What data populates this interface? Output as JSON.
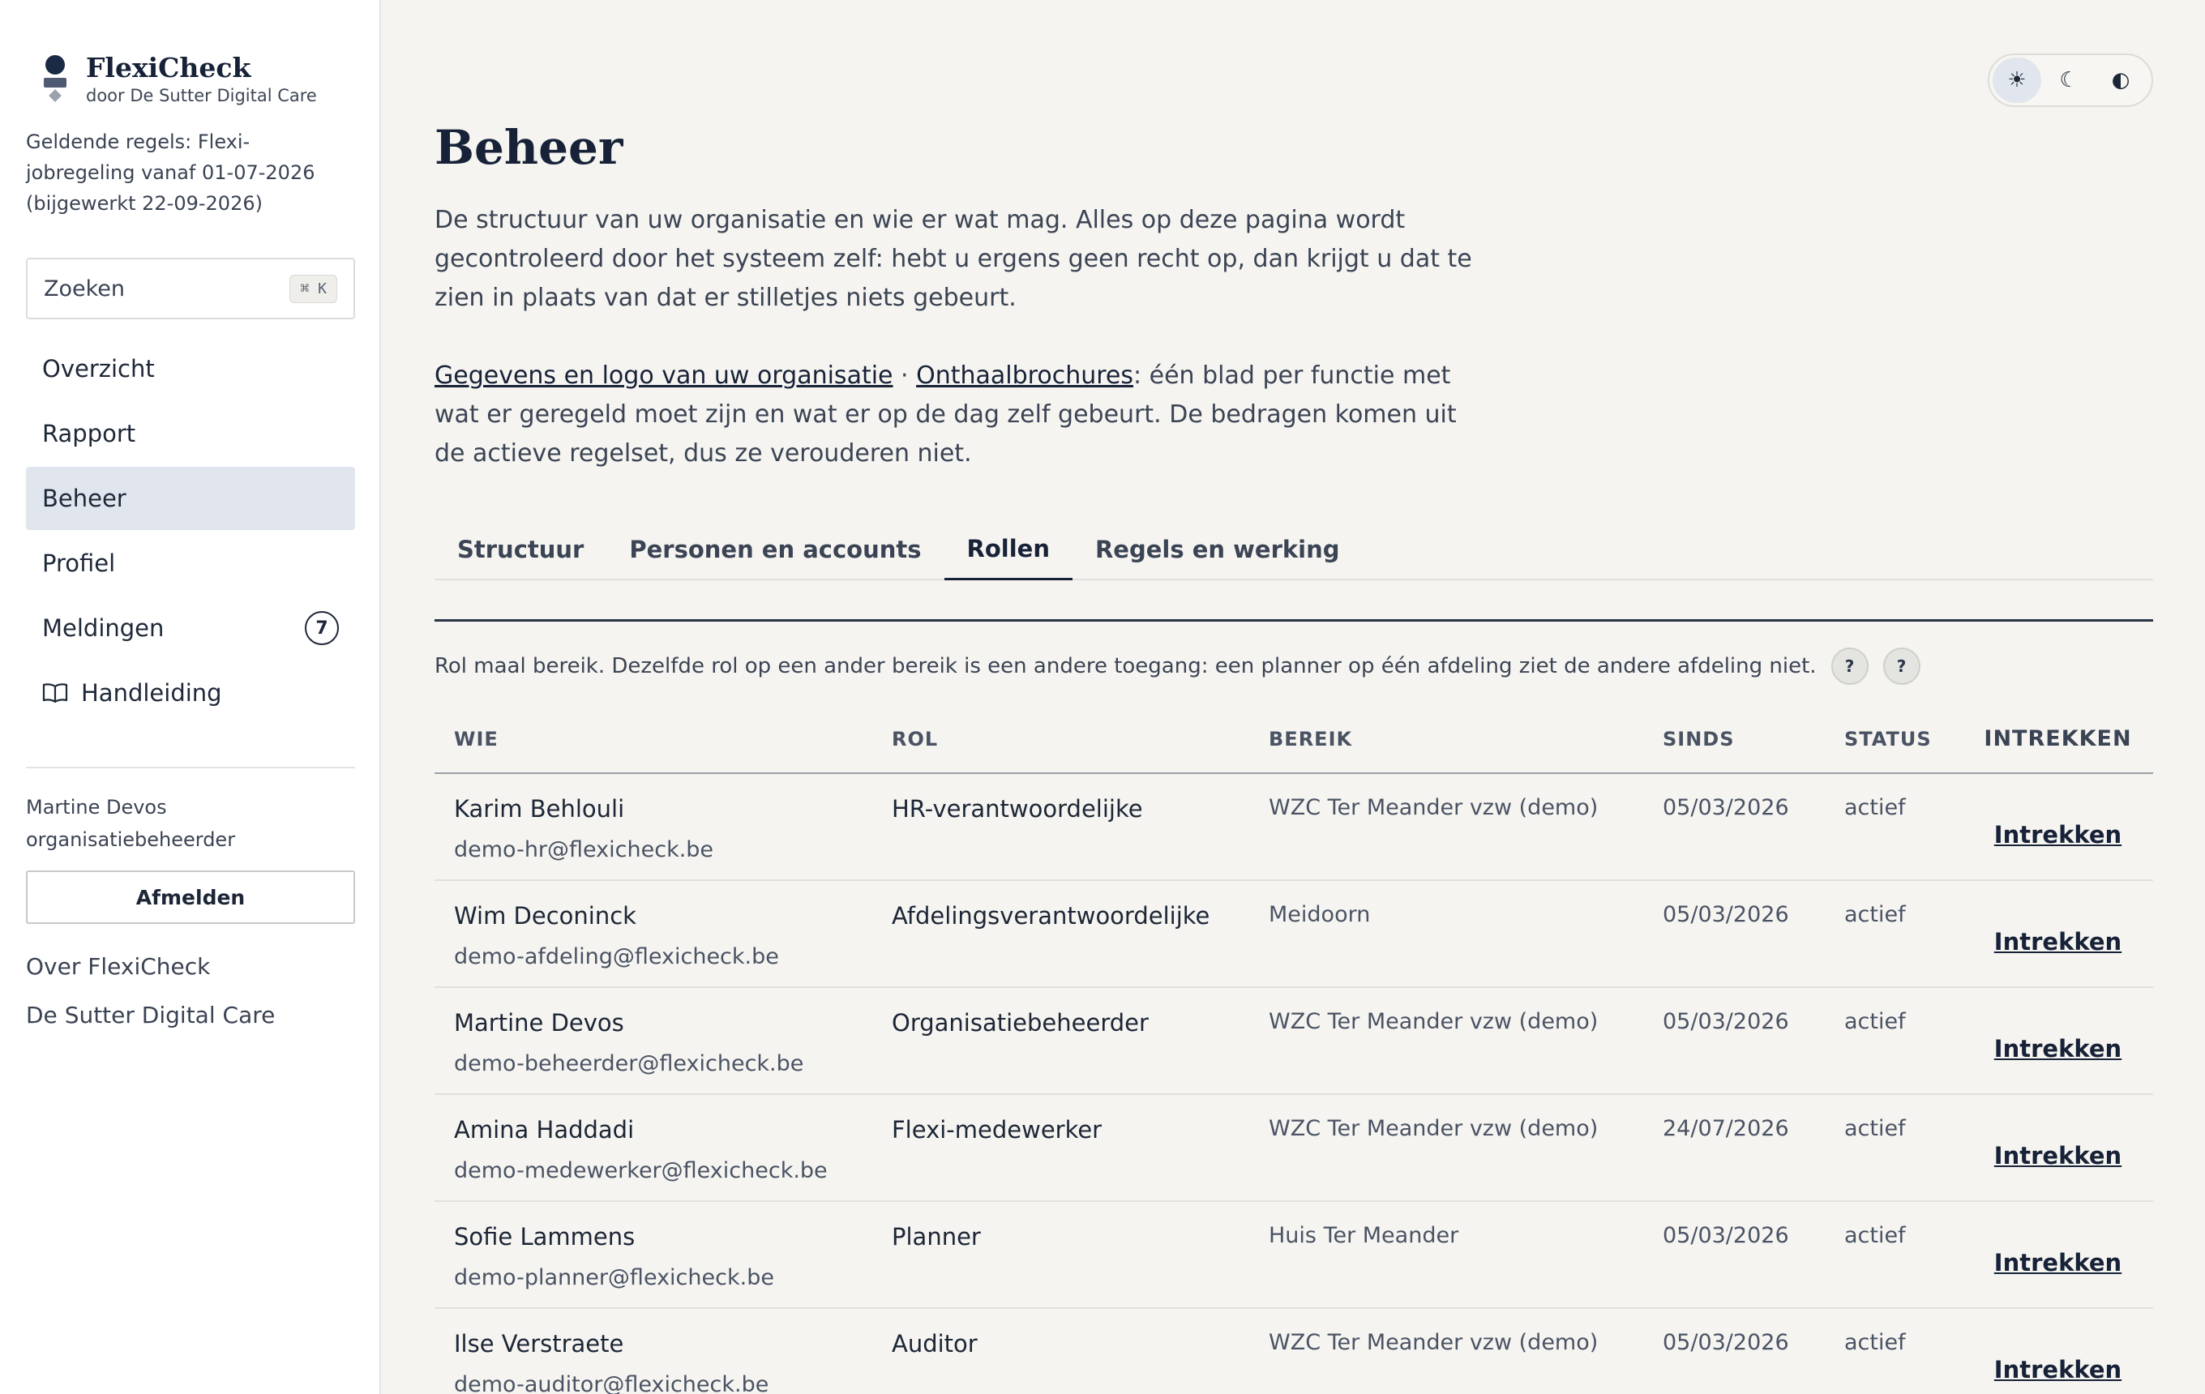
{
  "brand": {
    "title": "FlexiCheck",
    "subtitle": "door De Sutter Digital Care"
  },
  "rules_note": "Geldende regels: Flexi-jobregeling vanaf 01-07-2026 (bijgewerkt 22-09-2026)",
  "search": {
    "label": "Zoeken",
    "shortcut": "⌘ K"
  },
  "nav": {
    "items": [
      {
        "label": "Overzicht"
      },
      {
        "label": "Rapport"
      },
      {
        "label": "Beheer"
      },
      {
        "label": "Profiel"
      },
      {
        "label": "Meldingen",
        "badge": "7"
      },
      {
        "label": "Handleiding"
      }
    ]
  },
  "user": {
    "name": "Martine Devos",
    "role": "organisatiebeheerder",
    "logout": "Afmelden"
  },
  "footer_links": [
    "Over FlexiCheck",
    "De Sutter Digital Care"
  ],
  "theme": {
    "light": "☀",
    "dark": "☾",
    "contrast": "◐"
  },
  "page": {
    "title": "Beheer",
    "intro": "De structuur van uw organisatie en wie er wat mag. Alles op deze pagina wordt gecontroleerd door het systeem zelf: hebt u ergens geen recht op, dan krijgt u dat te zien in plaats van dat er stilletjes niets gebeurt.",
    "link1": "Gegevens en logo van uw organisatie",
    "sep": " · ",
    "link2": "Onthaalbrochures",
    "intro2_rest": ": één blad per functie met wat er geregeld moet zijn en wat er op de dag zelf gebeurt. De bedragen komen uit de actieve regelset, dus ze verouderen niet."
  },
  "tabs": [
    "Structuur",
    "Personen en accounts",
    "Rollen",
    "Regels en werking"
  ],
  "caption": "Rol maal bereik. Dezelfde rol op een ander bereik is een andere toegang: een planner op één afdeling ziet de andere afdeling niet.",
  "help_label": "?",
  "table": {
    "headers": {
      "who": "WIE",
      "role": "ROL",
      "scope": "BEREIK",
      "since": "SINDS",
      "status": "STATUS",
      "revoke": "INTREKKEN"
    },
    "rows": [
      {
        "name": "Karim Behlouli",
        "email": "demo-hr@flexicheck.be",
        "role": "HR-verantwoordelijke",
        "scope": "WZC Ter Meander vzw (demo)",
        "since": "05/03/2026",
        "status": "actief",
        "action": "Intrekken"
      },
      {
        "name": "Wim Deconinck",
        "email": "demo-afdeling@flexicheck.be",
        "role": "Afdelingsverantwoordelijke",
        "scope": "Meidoorn",
        "since": "05/03/2026",
        "status": "actief",
        "action": "Intrekken"
      },
      {
        "name": "Martine Devos",
        "email": "demo-beheerder@flexicheck.be",
        "role": "Organisatiebeheerder",
        "scope": "WZC Ter Meander vzw (demo)",
        "since": "05/03/2026",
        "status": "actief",
        "action": "Intrekken"
      },
      {
        "name": "Amina Haddadi",
        "email": "demo-medewerker@flexicheck.be",
        "role": "Flexi-medewerker",
        "scope": "WZC Ter Meander vzw (demo)",
        "since": "24/07/2026",
        "status": "actief",
        "action": "Intrekken"
      },
      {
        "name": "Sofie Lammens",
        "email": "demo-planner@flexicheck.be",
        "role": "Planner",
        "scope": "Huis Ter Meander",
        "since": "05/03/2026",
        "status": "actief",
        "action": "Intrekken"
      },
      {
        "name": "Ilse Verstraete",
        "email": "demo-auditor@flexicheck.be",
        "role": "Auditor",
        "scope": "WZC Ter Meander vzw (demo)",
        "since": "05/03/2026",
        "status": "actief",
        "action": "Intrekken"
      }
    ]
  }
}
